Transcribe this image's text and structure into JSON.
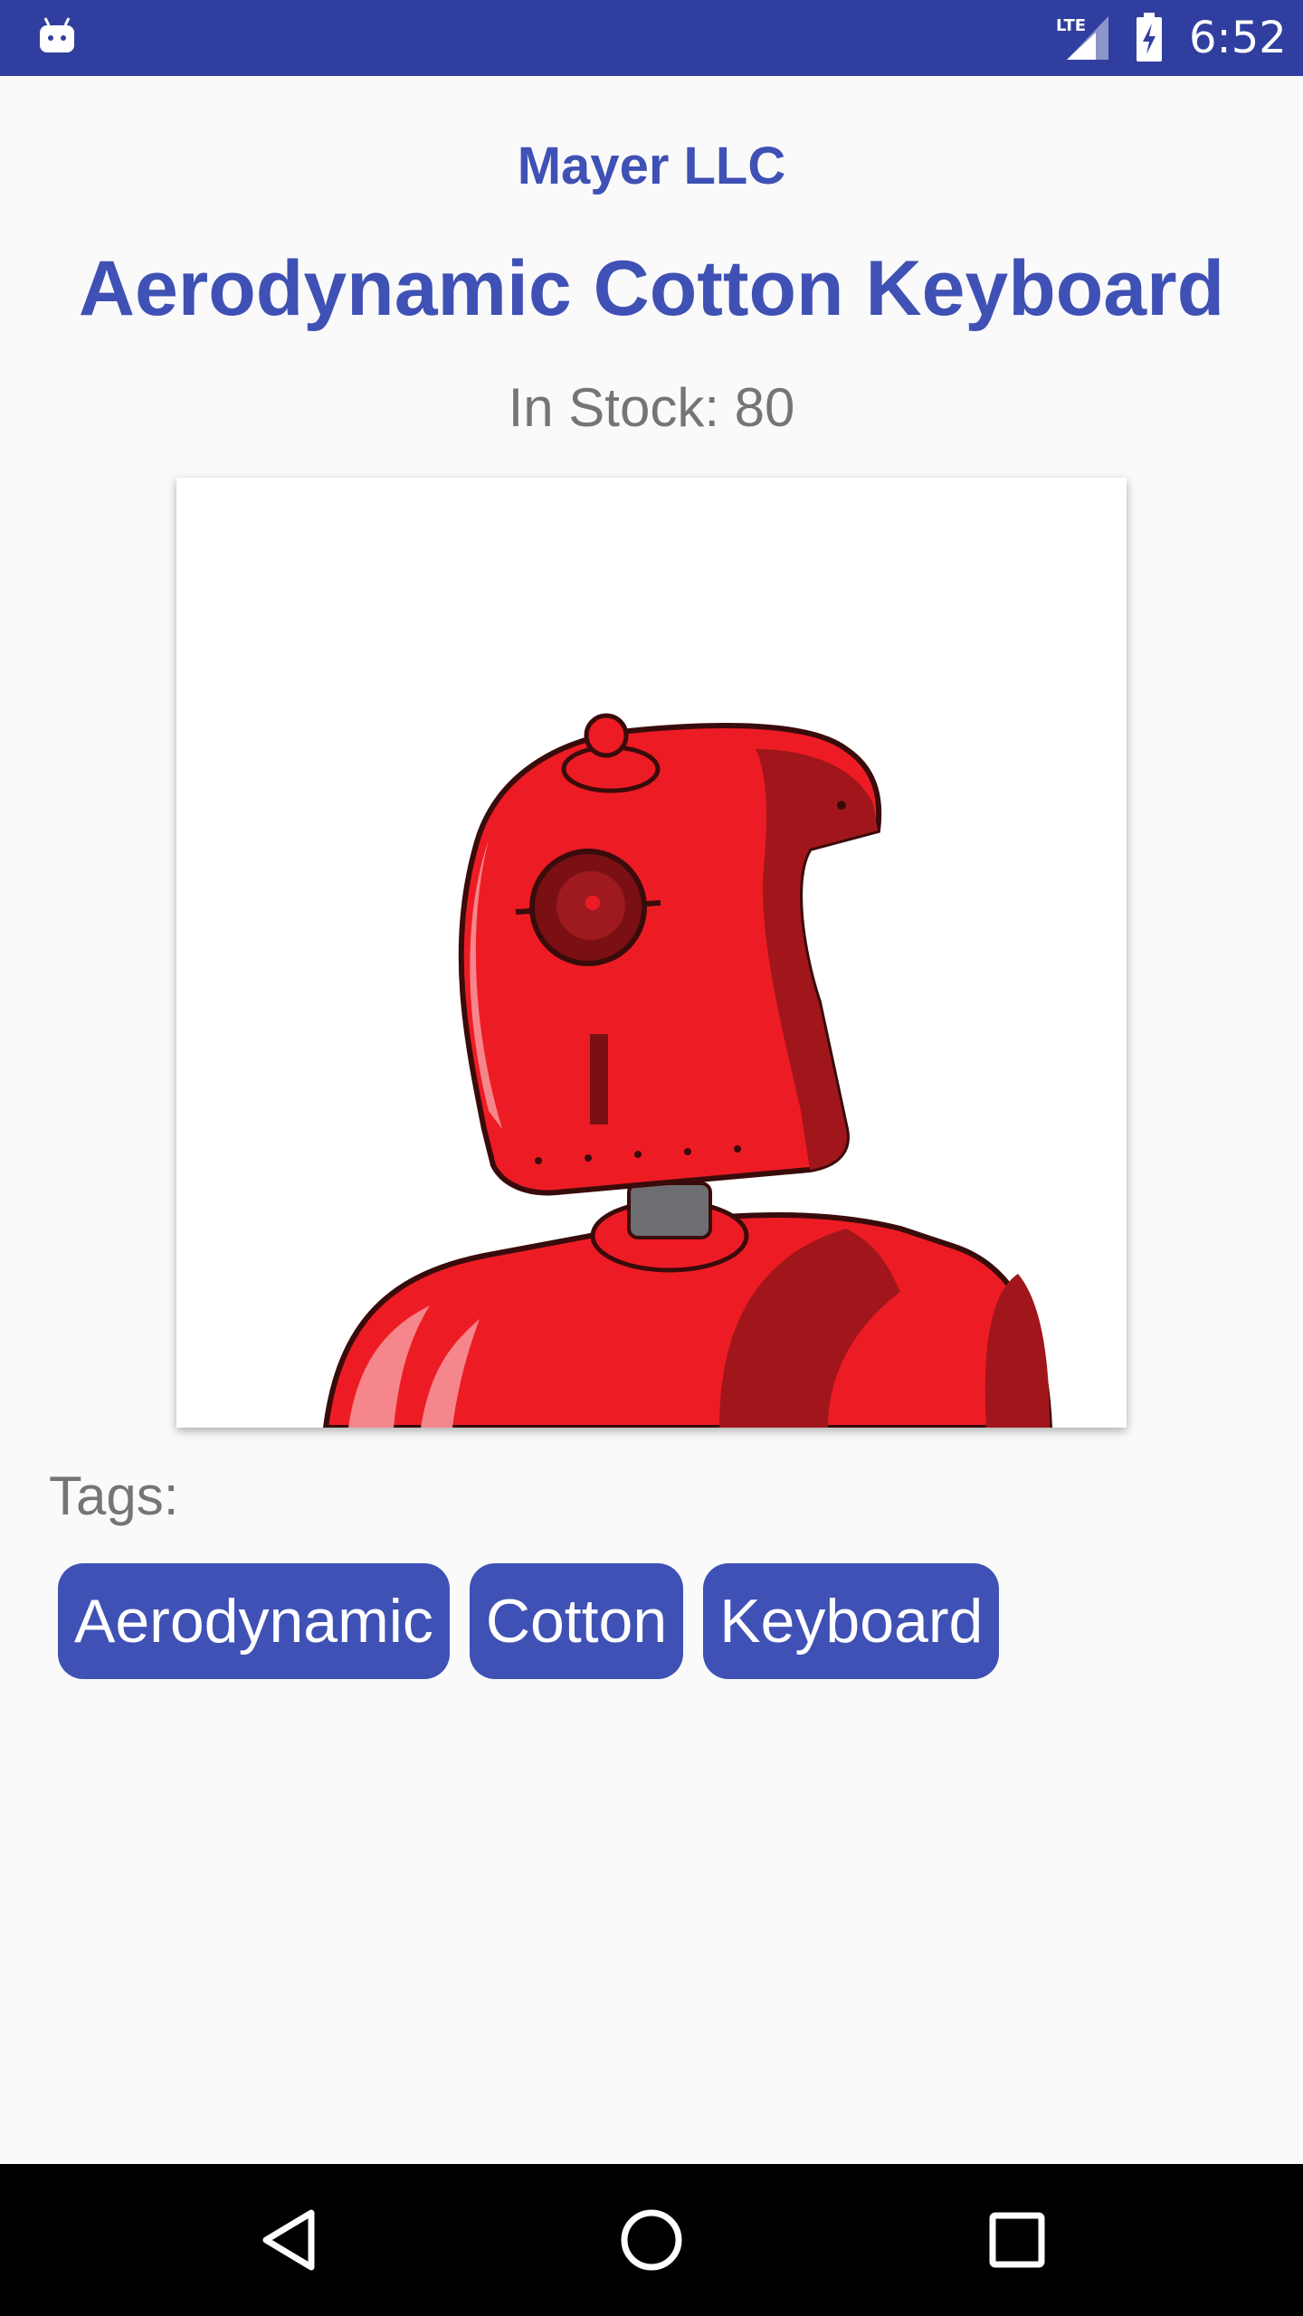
{
  "status_bar": {
    "time": "6:52",
    "network": "LTE",
    "color": "#303f9f"
  },
  "product": {
    "company": "Mayer LLC",
    "title": "Aerodynamic Cotton Keyboard",
    "stock": "In Stock: 80",
    "image_icon": "red-robot-image"
  },
  "tags": {
    "label": "Tags:",
    "items": [
      "Aerodynamic",
      "Cotton",
      "Keyboard"
    ]
  },
  "theme": {
    "primary": "#3f51b5",
    "primary_dark": "#303f9f",
    "secondary_text": "#757575"
  },
  "nav_bar": {
    "back_icon": "back-triangle-icon",
    "home_icon": "home-circle-icon",
    "recents_icon": "recents-square-icon"
  }
}
